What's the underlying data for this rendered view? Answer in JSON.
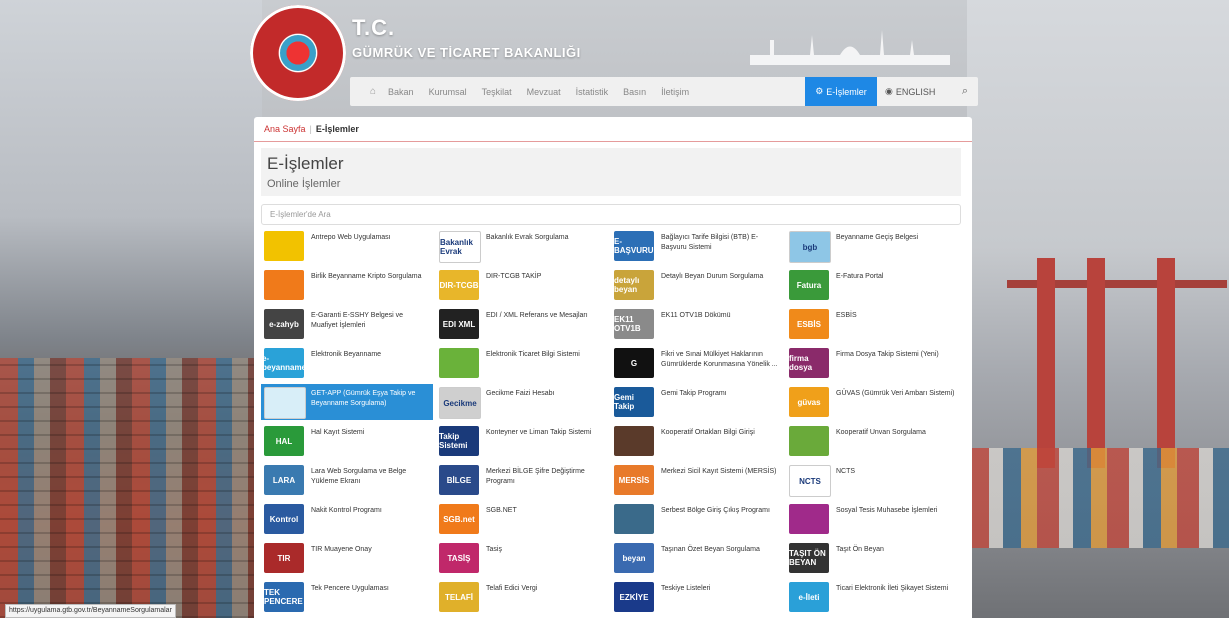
{
  "header": {
    "title": "T.C.",
    "subtitle": "GÜMRÜK VE TİCARET BAKANLIĞI",
    "nav": [
      "Bakan",
      "Kurumsal",
      "Teşkilat",
      "Mevzuat",
      "İstatistik",
      "Basın",
      "İletişim"
    ],
    "eislemler_label": "E-İşlemler",
    "english_label": "ENGLISH"
  },
  "breadcrumb": {
    "home": "Ana Sayfa",
    "current": "E-İşlemler"
  },
  "page": {
    "title": "E-İşlemler",
    "subtitle": "Online İşlemler",
    "search_placeholder": "E-İşlemler'de Ara"
  },
  "items": [
    {
      "label": "Antrepo Web Uygulaması",
      "color": "#f2c200"
    },
    {
      "label": "Bakanlık Evrak Sorgulama",
      "color": "#ffffff"
    },
    {
      "label": "Bağlayıcı Tarife Bilgisi (BTB) E-Başvuru Sistemi",
      "color": "#2c6fb6"
    },
    {
      "label": "Beyanname Geçiş Belgesi",
      "color": "#8ec6e6"
    },
    {
      "label": "Birlik Beyanname Kripto Sorgulama",
      "color": "#f07a1a"
    },
    {
      "label": "DIR-TCGB TAKİP",
      "color": "#e8b62a"
    },
    {
      "label": "Detaylı Beyan Durum Sorgulama",
      "color": "#c9a43a"
    },
    {
      "label": "E-Fatura Portal",
      "color": "#3a9a3a"
    },
    {
      "label": "E-Garanti E-SSHY Belgesi ve Muafiyet İşlemleri",
      "color": "#444444"
    },
    {
      "label": "EDI / XML Referans ve Mesajları",
      "color": "#222222"
    },
    {
      "label": "EK11 OTV1B Dökümü",
      "color": "#8a8a8a"
    },
    {
      "label": "ESBİS",
      "color": "#f08a1a"
    },
    {
      "label": "Elektronik Beyanname",
      "color": "#2aa2d8"
    },
    {
      "label": "Elektronik Ticaret Bilgi Sistemi",
      "color": "#6ab23a"
    },
    {
      "label": "Fikri ve Sınai Mülkiyet Haklarının Gümrüklerde Korunmasına Yönelik ...",
      "color": "#111111"
    },
    {
      "label": "Firma Dosya Takip Sistemi (Yeni)",
      "color": "#8a2a6a"
    },
    {
      "label": "GET-APP (Gümrük Eşya Takip ve Beyanname Sorgulama)",
      "color": "#d8eef8"
    },
    {
      "label": "Gecikme Faizi Hesabı",
      "color": "#cfcfcf"
    },
    {
      "label": "Gemi Takip Programı",
      "color": "#1a5a9a"
    },
    {
      "label": "GÜVAS (Gümrük Veri Ambarı Sistemi)",
      "color": "#f0a01a"
    },
    {
      "label": "Hal Kayıt Sistemi",
      "color": "#2a9a3a"
    },
    {
      "label": "Konteyner ve Liman Takip Sistemi",
      "color": "#1a3a7a"
    },
    {
      "label": "Kooperatif Ortakları Bilgi Girişi",
      "color": "#5a3a2a"
    },
    {
      "label": "Kooperatif Unvan Sorgulama",
      "color": "#6aaa3a"
    },
    {
      "label": "Lara Web Sorgulama ve Belge Yükleme Ekranı",
      "color": "#3a7ab0"
    },
    {
      "label": "Merkezi BİLGE Şifre Değiştirme Programı",
      "color": "#2a4a8a"
    },
    {
      "label": "Merkezi Sicil Kayıt Sistemi (MERSİS)",
      "color": "#e87a2a"
    },
    {
      "label": "NCTS",
      "color": "#ffffff"
    },
    {
      "label": "Nakit Kontrol Programı",
      "color": "#2a5aa0"
    },
    {
      "label": "SGB.NET",
      "color": "#f07a1a"
    },
    {
      "label": "Serbest Bölge Giriş Çıkış Programı",
      "color": "#3a6a8a"
    },
    {
      "label": "Sosyal Tesis Muhasebe İşlemleri",
      "color": "#a02a8a"
    },
    {
      "label": "TIR Muayene Onay",
      "color": "#aa2a2a"
    },
    {
      "label": "Tasiş",
      "color": "#c0286a"
    },
    {
      "label": "Taşınan Özet Beyan Sorgulama",
      "color": "#3a6ab0"
    },
    {
      "label": "Taşıt Ön Beyan",
      "color": "#333333"
    },
    {
      "label": "Tek Pencere Uygulaması",
      "color": "#2a6ab0"
    },
    {
      "label": "Telafi Edici Vergi",
      "color": "#e0b02a"
    },
    {
      "label": "Teskiye Listeleri",
      "color": "#1a3a8a"
    },
    {
      "label": "Ticari Elektronik İleti Şikayet Sistemi",
      "color": "#2aa0d8"
    }
  ],
  "icon_texts": [
    "",
    "Bakanlık Evrak",
    "E-BAŞVURU",
    "bgb",
    "",
    "DIR-TCGB",
    "detaylı beyan",
    "Fatura",
    "e-zahyb",
    "EDI XML",
    "EK11 OTV1B",
    "ESBİS",
    "e-beyanname",
    "",
    "G",
    "firma dosya",
    "",
    "Gecikme",
    "Gemi Takip",
    "güvas",
    "HAL",
    "Takip Sistemi",
    "",
    "",
    "LARA",
    "BİLGE",
    "MERSİS",
    "NCTS",
    "Kontrol",
    "SGB.net",
    "",
    "",
    "TIR",
    "TASİŞ",
    "beyan",
    "TAŞIT ÖN BEYAN",
    "TEK PENCERE",
    "TELAFİ",
    "EZKİYE",
    "e-İleti"
  ],
  "status_url": "https://uygulama.gtb.gov.tr/BeyannameSorgulamalar"
}
